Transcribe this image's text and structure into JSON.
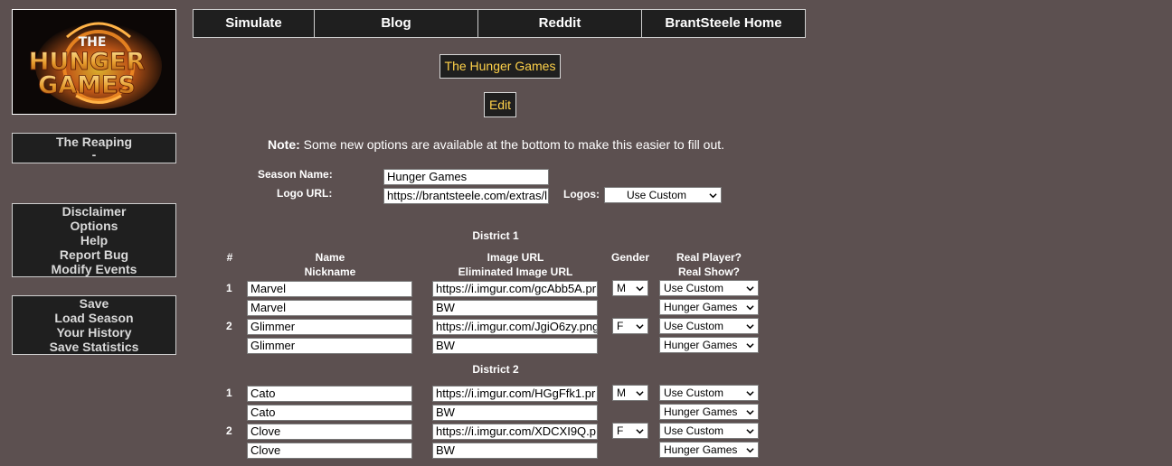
{
  "logo": {
    "line1": "THE",
    "line2": "HUNGER",
    "line3": "GAMES"
  },
  "nav": [
    "Simulate",
    "Blog",
    "Reddit",
    "BrantSteele Home"
  ],
  "sidebar": {
    "reaping": {
      "title": "The Reaping",
      "sub": "-"
    },
    "info": [
      "Disclaimer",
      "Options",
      "Help",
      "Report Bug",
      "Modify Events"
    ],
    "actions": [
      "Save",
      "Load Season",
      "Your History",
      "Save Statistics"
    ]
  },
  "main": {
    "season_button": "The Hunger Games",
    "edit_button": "Edit",
    "note_label": "Note:",
    "note_text": " Some new options are available at the bottom to make this easier to fill out.",
    "season_name_label": "Season Name:",
    "season_name_value": "Hunger Games",
    "logo_url_label": "Logo URL:",
    "logo_url_value": "https://brantsteele.com/extras/l",
    "logos_label": "Logos:",
    "logos_value": "Use Custom"
  },
  "table": {
    "hash": "#",
    "name": "Name",
    "nickname": "Nickname",
    "image_url": "Image URL",
    "elim_url": "Eliminated Image URL",
    "gender": "Gender",
    "real_player": "Real Player?",
    "real_show": "Real Show?"
  },
  "districts": [
    {
      "title": "District 1",
      "tributes": [
        {
          "num": "1",
          "name": "Marvel",
          "nickname": "Marvel",
          "image": "https://i.imgur.com/gcAbb5A.pr",
          "elim": "BW",
          "gender": "M",
          "player": "Use Custom",
          "show": "Hunger Games"
        },
        {
          "num": "2",
          "name": "Glimmer",
          "nickname": "Glimmer",
          "image": "https://i.imgur.com/JgiO6zy.png",
          "elim": "BW",
          "gender": "F",
          "player": "Use Custom",
          "show": "Hunger Games"
        }
      ]
    },
    {
      "title": "District 2",
      "tributes": [
        {
          "num": "1",
          "name": "Cato",
          "nickname": "Cato",
          "image": "https://i.imgur.com/HGgFfk1.pr",
          "elim": "BW",
          "gender": "M",
          "player": "Use Custom",
          "show": "Hunger Games"
        },
        {
          "num": "2",
          "name": "Clove",
          "nickname": "Clove",
          "image": "https://i.imgur.com/XDCXI9Q.p",
          "elim": "BW",
          "gender": "F",
          "player": "Use Custom",
          "show": "Hunger Games"
        }
      ]
    }
  ]
}
